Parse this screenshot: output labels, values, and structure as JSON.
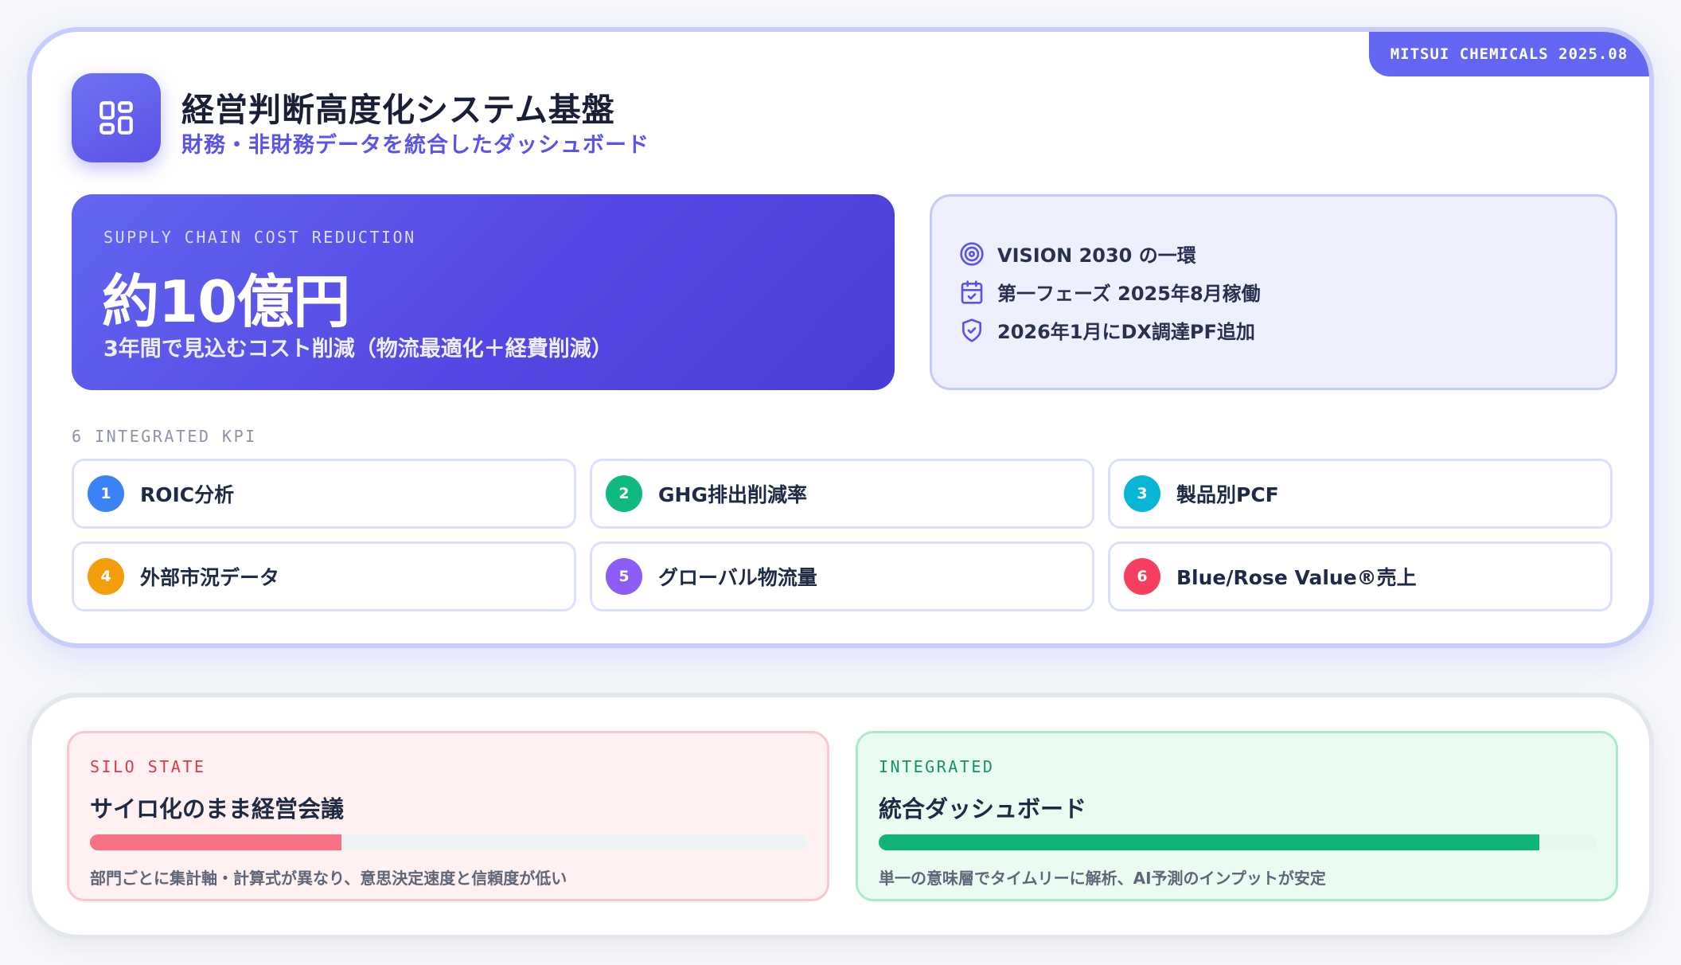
{
  "header": {
    "corner_tag": "MITSUI CHEMICALS 2025.08",
    "logo_icon": "dashboard-grid-icon",
    "title": "経営判断高度化システム基盤",
    "subtitle": "財務・非財務データを統合したダッシュボード"
  },
  "hero": {
    "label": "SUPPLY CHAIN COST REDUCTION",
    "value": "約10億円",
    "description": "3年間で見込むコスト削減（物流最適化＋経費削減）"
  },
  "vision": {
    "items": [
      {
        "icon": "target-icon",
        "text": "VISION 2030 の一環"
      },
      {
        "icon": "calendar-check-icon",
        "text": "第一フェーズ 2025年8月稼働"
      },
      {
        "icon": "shield-check-icon",
        "text": "2026年1月にDX調達PF追加"
      }
    ]
  },
  "kpis": {
    "heading": "6 INTEGRATED KPI",
    "items": [
      {
        "number": "1",
        "label": "ROIC分析",
        "color": "#3b82f6"
      },
      {
        "number": "2",
        "label": "GHG排出削減率",
        "color": "#10b981"
      },
      {
        "number": "3",
        "label": "製品別PCF",
        "color": "#06b6d4"
      },
      {
        "number": "4",
        "label": "外部市況データ",
        "color": "#f59e0b"
      },
      {
        "number": "5",
        "label": "グローバル物流量",
        "color": "#8b5cf6"
      },
      {
        "number": "6",
        "label": "Blue/Rose Value®売上",
        "color": "#f43f5e"
      }
    ]
  },
  "comparison": {
    "silo": {
      "label": "SILO STATE",
      "title": "サイロ化のまま経営会議",
      "progress": 0.35,
      "color": "#f87185",
      "description": "部門ごとに集計軸・計算式が異なり、意思決定速度と信頼度が低い"
    },
    "integrated": {
      "label": "INTEGRATED",
      "title": "統合ダッシュボード",
      "progress": 0.92,
      "color": "#10b478",
      "description": "単一の意味層でタイムリーに解析、AI予測のインプットが安定"
    }
  },
  "colors": {
    "accent": "#6366f1",
    "hero_gradient_start": "#6366f1",
    "hero_gradient_end": "#4a3cd6"
  }
}
